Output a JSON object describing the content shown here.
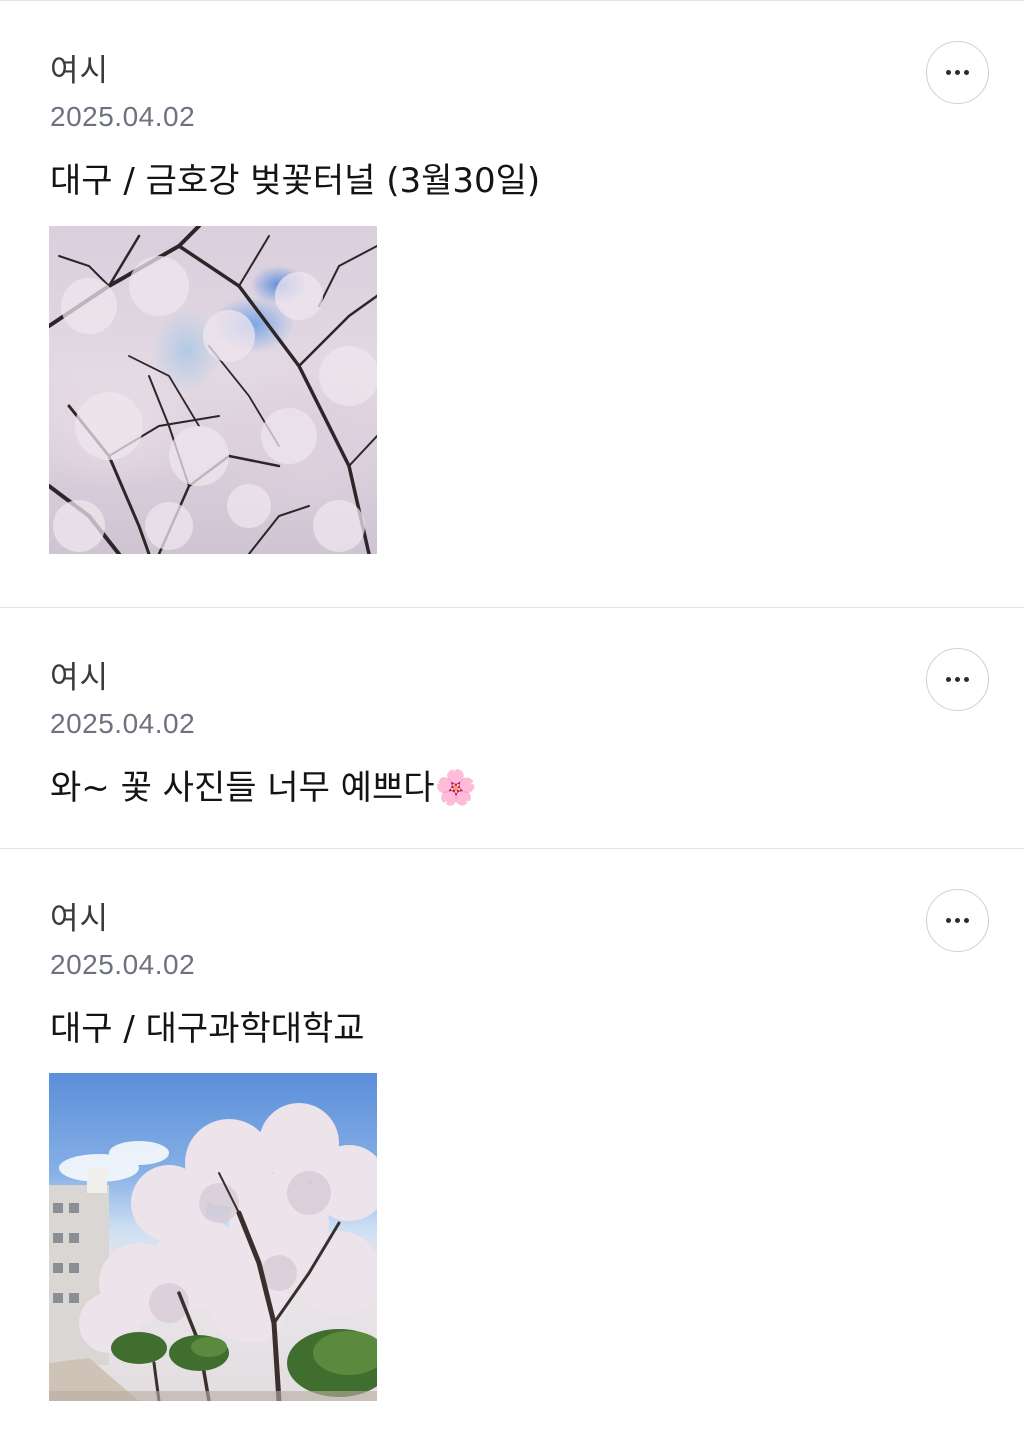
{
  "comments": [
    {
      "author": "여시",
      "date": "2025.04.02",
      "text": "대구 / 금호강 벚꽃터널 (3월30일)",
      "has_image": true
    },
    {
      "author": "여시",
      "date": "2025.04.02",
      "text": "와~ 꽃 사진들 너무 예쁘다🌸",
      "has_image": false
    },
    {
      "author": "여시",
      "date": "2025.04.02",
      "text": "대구 / 대구과학대학교",
      "has_image": true
    }
  ],
  "icons": {
    "more": "more-horizontal-icon"
  },
  "colors": {
    "divider": "#e4e4e6",
    "date_text": "#6e7280",
    "body_text": "#141416"
  }
}
